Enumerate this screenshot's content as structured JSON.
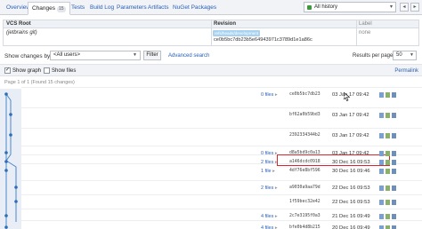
{
  "tabs": [
    {
      "label": "Overview",
      "active": false
    },
    {
      "label": "Changes",
      "active": true,
      "count": "15"
    },
    {
      "label": "Tests",
      "active": false
    },
    {
      "label": "Build Log",
      "active": false
    },
    {
      "label": "Parameters",
      "active": false
    },
    {
      "label": "Artifacts",
      "active": false
    },
    {
      "label": "NuGet Packages",
      "active": false
    }
  ],
  "history": {
    "label": "All history",
    "status_color": "#3a9b3a"
  },
  "vcs_table": {
    "headers": {
      "root": "VCS Root",
      "revision": "Revision",
      "label": "Label"
    },
    "row": {
      "root": "(jetbrains git)",
      "branch_badge": "refs/heads/development",
      "revision": "ce0b5bc7db23b5e64943971c3789d1e1a86c",
      "label": "none"
    }
  },
  "filter": {
    "label": "Show changes by:",
    "select_value": "<All users>",
    "button": "Filter",
    "advanced_link": "Advanced search",
    "results_label": "Results per page:",
    "results_value": "50"
  },
  "toolbar": {
    "show_graph": {
      "label": "Show graph",
      "checked": true
    },
    "show_files": {
      "label": "Show files",
      "checked": false
    },
    "permalink": "Permalink"
  },
  "page_info": "Page 1 of 1 (Found 15 changes)",
  "changes": [
    {
      "files": "0 files",
      "hash": "ce0b5bc7db23",
      "date": "03 Jan 17 09:42",
      "highlighted": false
    },
    {
      "files": "",
      "hash": "bf62a0b59bd3",
      "date": "03 Jan 17 09:42",
      "highlighted": false
    },
    {
      "files": "",
      "hash": "2392334344b2",
      "date": "03 Jan 17 09:42",
      "highlighted": false
    },
    {
      "files": "0 files",
      "hash": "d8a5bd9c0a13",
      "date": "03 Jan 17 09:42",
      "highlighted": false
    },
    {
      "files": "2 files",
      "hash": "a146dcdc0918",
      "date": "30 Dec 16 09:53",
      "highlighted": true
    },
    {
      "files": "1 file",
      "hash": "4df76e8bf596",
      "date": "30 Dec 16 09:46",
      "highlighted": false
    },
    {
      "files": "2 files",
      "hash": "a9030a9aa79d",
      "date": "22 Dec 16 09:53",
      "highlighted": false
    },
    {
      "files": "",
      "hash": "1f59bec32e42",
      "date": "22 Dec 16 09:53",
      "highlighted": false
    },
    {
      "files": "4 files",
      "hash": "2c7e3195f0a3",
      "date": "21 Dec 16 09:49",
      "highlighted": false
    },
    {
      "files": "4 files",
      "hash": "bfe0b4d8b215",
      "date": "20 Dec 16 09:49",
      "highlighted": false
    }
  ]
}
